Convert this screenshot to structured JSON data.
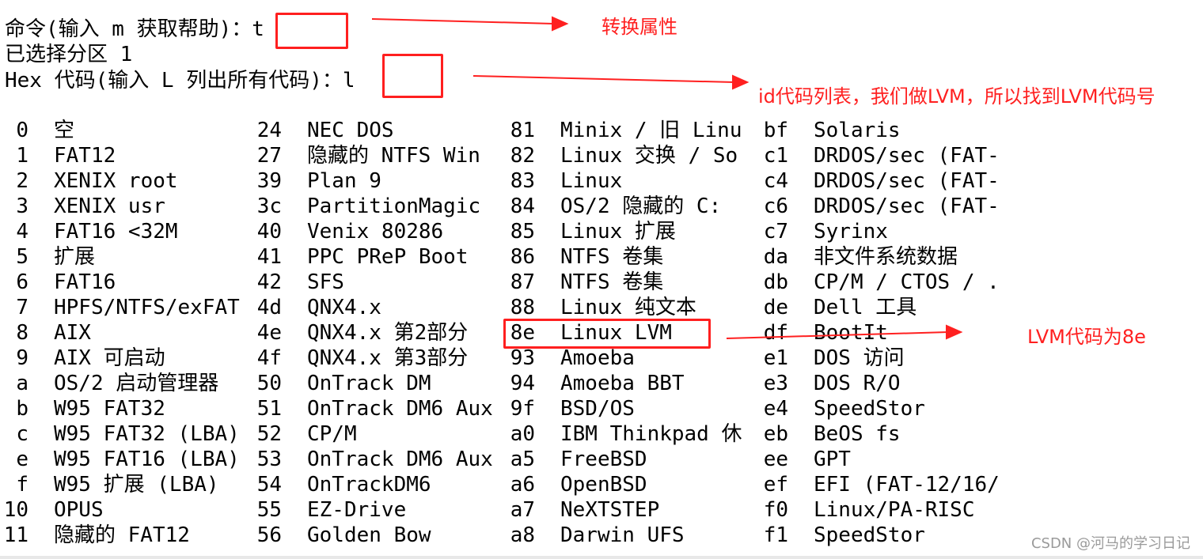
{
  "prompts": [
    {
      "text": "命令(输入 m 获取帮助)：",
      "input": "t"
    },
    {
      "text": "已选择分区 1"
    },
    {
      "text": "Hex 代码(输入 L 列出所有代码)：",
      "input": "l"
    }
  ],
  "table": {
    "columns": [
      [
        [
          "0",
          "空"
        ],
        [
          "1",
          "FAT12"
        ],
        [
          "2",
          "XENIX root"
        ],
        [
          "3",
          "XENIX usr"
        ],
        [
          "4",
          "FAT16 <32M"
        ],
        [
          "5",
          "扩展"
        ],
        [
          "6",
          "FAT16"
        ],
        [
          "7",
          "HPFS/NTFS/exFAT"
        ],
        [
          "8",
          "AIX"
        ],
        [
          "9",
          "AIX 可启动"
        ],
        [
          "a",
          "OS/2 启动管理器"
        ],
        [
          "b",
          "W95 FAT32"
        ],
        [
          "c",
          "W95 FAT32 (LBA)"
        ],
        [
          "e",
          "W95 FAT16 (LBA)"
        ],
        [
          "f",
          "W95 扩展 (LBA)"
        ],
        [
          "10",
          "OPUS"
        ],
        [
          "11",
          "隐藏的 FAT12"
        ]
      ],
      [
        [
          "24",
          "NEC DOS"
        ],
        [
          "27",
          "隐藏的 NTFS Win"
        ],
        [
          "39",
          "Plan 9"
        ],
        [
          "3c",
          "PartitionMagic"
        ],
        [
          "40",
          "Venix 80286"
        ],
        [
          "41",
          "PPC PReP Boot"
        ],
        [
          "42",
          "SFS"
        ],
        [
          "4d",
          "QNX4.x"
        ],
        [
          "4e",
          "QNX4.x 第2部分"
        ],
        [
          "4f",
          "QNX4.x 第3部分"
        ],
        [
          "50",
          "OnTrack DM"
        ],
        [
          "51",
          "OnTrack DM6 Aux"
        ],
        [
          "52",
          "CP/M"
        ],
        [
          "53",
          "OnTrack DM6 Aux"
        ],
        [
          "54",
          "OnTrackDM6"
        ],
        [
          "55",
          "EZ-Drive"
        ],
        [
          "56",
          "Golden Bow"
        ]
      ],
      [
        [
          "81",
          "Minix / 旧 Linu"
        ],
        [
          "82",
          "Linux 交换 / So"
        ],
        [
          "83",
          "Linux"
        ],
        [
          "84",
          "OS/2 隐藏的 C:"
        ],
        [
          "85",
          "Linux 扩展"
        ],
        [
          "86",
          "NTFS 卷集"
        ],
        [
          "87",
          "NTFS 卷集"
        ],
        [
          "88",
          "Linux 纯文本"
        ],
        [
          "8e",
          "Linux LVM"
        ],
        [
          "93",
          "Amoeba"
        ],
        [
          "94",
          "Amoeba BBT"
        ],
        [
          "9f",
          "BSD/OS"
        ],
        [
          "a0",
          "IBM Thinkpad 休"
        ],
        [
          "a5",
          "FreeBSD"
        ],
        [
          "a6",
          "OpenBSD"
        ],
        [
          "a7",
          "NeXTSTEP"
        ],
        [
          "a8",
          "Darwin UFS"
        ]
      ],
      [
        [
          "bf",
          "Solaris"
        ],
        [
          "c1",
          "DRDOS/sec (FAT-"
        ],
        [
          "c4",
          "DRDOS/sec (FAT-"
        ],
        [
          "c6",
          "DRDOS/sec (FAT-"
        ],
        [
          "c7",
          "Syrinx"
        ],
        [
          "da",
          "非文件系统数据"
        ],
        [
          "db",
          "CP/M / CTOS / ."
        ],
        [
          "de",
          "Dell 工具"
        ],
        [
          "df",
          "BootIt"
        ],
        [
          "e1",
          "DOS 访问"
        ],
        [
          "e3",
          "DOS R/O"
        ],
        [
          "e4",
          "SpeedStor"
        ],
        [
          "eb",
          "BeOS fs"
        ],
        [
          "ee",
          "GPT"
        ],
        [
          "ef",
          "EFI (FAT-12/16/"
        ],
        [
          "f0",
          "Linux/PA-RISC"
        ],
        [
          "f1",
          "SpeedStor"
        ]
      ]
    ]
  },
  "annotations": {
    "convert": "转换属性",
    "list": "id代码列表，我们做LVM，所以找到LVM代码号",
    "lvm": "LVM代码为8e"
  },
  "watermark": "CSDN @河马的学习日记",
  "colors": {
    "annotation": "#ff2020",
    "text": "#000000",
    "background": "#ffffff"
  }
}
